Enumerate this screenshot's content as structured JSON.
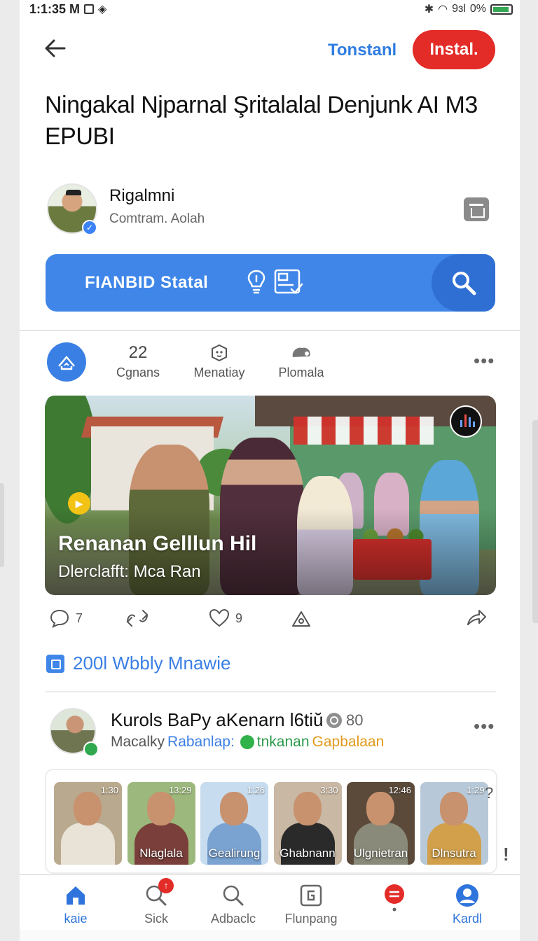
{
  "status_bar": {
    "time": "1:1:35 M",
    "signal_text": "9ɜl",
    "battery": "0%"
  },
  "header": {
    "link_label": "Tonstanl",
    "install_label": "Instal."
  },
  "article": {
    "title": "Ningakal Njparnal Şritalalal Denjunk AI M3 EPUBI"
  },
  "author": {
    "name": "Rigalmni",
    "subtitle": "Comtram. Aolah"
  },
  "search": {
    "label": "FIANBID Statal"
  },
  "tabs": [
    {
      "top": "22",
      "label": "Cgnans"
    },
    {
      "top": "",
      "label": "Menatiay"
    },
    {
      "top": "",
      "label": "Plomala"
    }
  ],
  "hero": {
    "title": "Renanan Gelllun Hil",
    "subtitle": "Dlerclafft: Mca Ran"
  },
  "actions": {
    "comments": "7",
    "likes": "9"
  },
  "link": {
    "text": "200l Wbbly Mnawie"
  },
  "post2": {
    "name": "Kurols BaPy aKenarn l6tiŭ",
    "count": "80",
    "sub_plain": "Macalky",
    "sub_blue": "Rabanlap:",
    "sub_green": "tnkanan",
    "sub_orange": "Gapbalaan"
  },
  "thumbnails": [
    {
      "time": "1:30",
      "name": "",
      "body_color": "#e9e2d6",
      "bg": "#b9a98e"
    },
    {
      "time": "13:29",
      "name": "Nlaglala",
      "body_color": "#7a3f3a",
      "bg": "#9cb87c"
    },
    {
      "time": "1:26",
      "name": "Gealirung",
      "body_color": "#7aa3d2",
      "bg": "#c7dcef"
    },
    {
      "time": "3:30",
      "name": "Ghabnann",
      "body_color": "#2a2a2a",
      "bg": "#c9b8a4"
    },
    {
      "time": "12:46",
      "name": "Ulgnietran",
      "body_color": "#8a8a7a",
      "bg": "#5b4a3a"
    },
    {
      "time": "1:29",
      "name": "Dlnsutra",
      "body_color": "#d2a04a",
      "bg": "#b7c9d8"
    }
  ],
  "thumb_more": "?",
  "thumb_exclaim": "!",
  "bottom_nav": [
    {
      "label": "kaie",
      "icon": "home-icon",
      "active": true
    },
    {
      "label": "Sick",
      "icon": "search-icon",
      "badge": "↑"
    },
    {
      "label": "Adbaclc",
      "icon": "search-icon"
    },
    {
      "label": "Flunpang",
      "icon": "tablet-icon"
    },
    {
      "label": "",
      "icon": "chat-icon"
    },
    {
      "label": "Kardl",
      "icon": "profile-icon",
      "active": true
    }
  ],
  "colors": {
    "accent_blue": "#3f86e8",
    "install_red": "#e32b27",
    "verified_green": "#2fa84f"
  }
}
